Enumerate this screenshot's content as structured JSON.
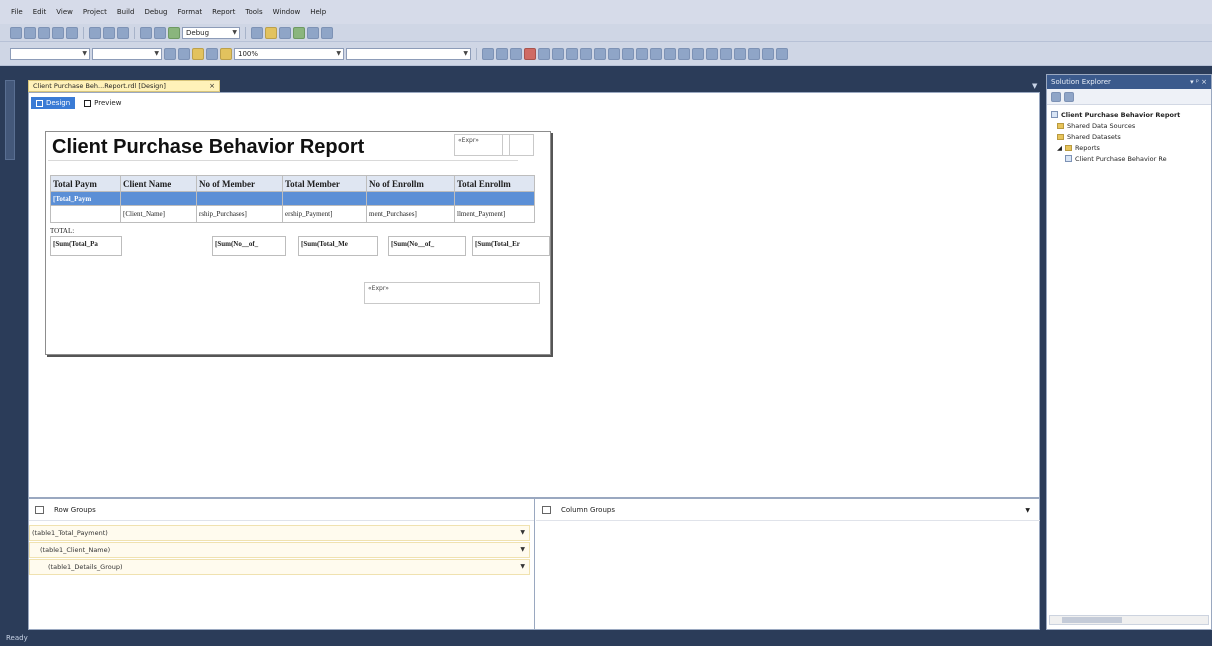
{
  "menubar": {
    "items": [
      "File",
      "Edit",
      "View",
      "Project",
      "Build",
      "Debug",
      "Format",
      "Report",
      "Tools",
      "Window",
      "Help"
    ]
  },
  "toolbar": {
    "config": "Debug",
    "zoom": "100%"
  },
  "document_tab": {
    "label": "Client Purchase Beh...Report.rdl [Design]",
    "close": "×"
  },
  "view_tabs": {
    "design": "Design",
    "preview": "Preview"
  },
  "report": {
    "title": "Client Purchase Behavior Report",
    "expr_top": "«Expr»",
    "expr_bottom": "«Expr»",
    "headers": [
      "Total Paym",
      "Client Name",
      "No of Member",
      "Total Member",
      "No of Enrollm",
      "Total Enrollm"
    ],
    "group_row": [
      "[Total_Paym",
      "",
      "",
      "",
      "",
      ""
    ],
    "detail_row": [
      "",
      "[Client_Name]",
      "rship_Purchases]",
      "ership_Payment]",
      "ment_Purchases]",
      "llment_Payment]"
    ],
    "total_label": "TOTAL:",
    "sums": [
      "[Sum(Total_Pa",
      "[Sum(No__of_",
      "[Sum(Total_Me",
      "[Sum(No__of_",
      "[Sum(Total_Er"
    ]
  },
  "row_groups": {
    "title": "Row Groups",
    "items": [
      "(table1_Total_Payment)",
      "(table1_Client_Name)",
      "(table1_Details_Group)"
    ]
  },
  "column_groups": {
    "title": "Column Groups"
  },
  "solution_explorer": {
    "title": "Solution Explorer",
    "pins": "▾ ᵖ ×",
    "project": "Client Purchase Behavior Report",
    "shared_data_sources": "Shared Data Sources",
    "shared_datasets": "Shared Datasets",
    "reports": "Reports",
    "report_file": "Client Purchase Behavior Re"
  },
  "status": {
    "text": "Ready"
  }
}
